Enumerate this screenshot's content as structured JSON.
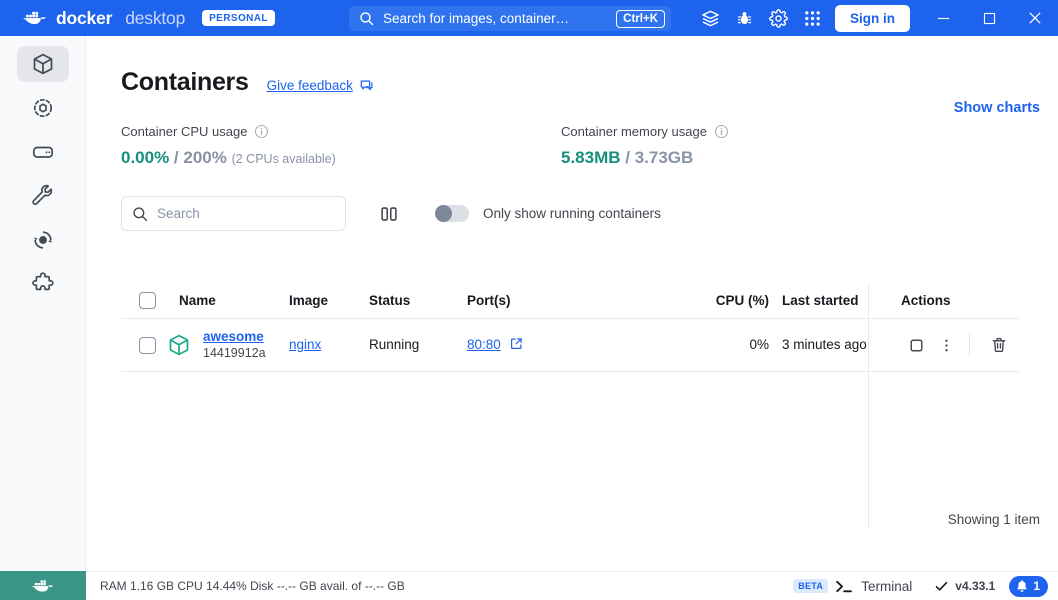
{
  "titlebar": {
    "brand_docker": "docker",
    "brand_desktop": "desktop",
    "plan_badge": "PERSONAL",
    "search_placeholder": "Search for images, container…",
    "search_shortcut": "Ctrl+K",
    "sign_in_label": "Sign in",
    "icons": [
      "extensions-icon",
      "bug-icon",
      "gear-icon",
      "apps-grid-icon"
    ],
    "window_controls": [
      "minimize",
      "maximize",
      "close"
    ],
    "accent_color": "#1d63ed"
  },
  "sidebar": {
    "items": [
      {
        "name": "containers",
        "icon": "cube-icon",
        "active": true
      },
      {
        "name": "images",
        "icon": "images-icon",
        "active": false
      },
      {
        "name": "volumes",
        "icon": "volumes-icon",
        "active": false
      },
      {
        "name": "builds",
        "icon": "wrench-icon",
        "active": false
      },
      {
        "name": "dev-environments",
        "icon": "dev-env-icon",
        "active": false
      },
      {
        "name": "extensions",
        "icon": "puzzle-icon",
        "active": false
      }
    ],
    "footer_icon": "whale-icon",
    "footer_color": "#3a9488"
  },
  "page": {
    "title": "Containers",
    "feedback_link": "Give feedback"
  },
  "stats": {
    "cpu": {
      "label": "Container CPU usage",
      "used": "0.00%",
      "separator": " / ",
      "total": "200%",
      "sub": "(2 CPUs available)"
    },
    "memory": {
      "label": "Container memory usage",
      "used": "5.83MB",
      "separator": " / ",
      "total": "3.73GB"
    },
    "show_charts": "Show charts",
    "used_color": "#168f7c"
  },
  "filters": {
    "search_placeholder": "Search",
    "search_value": "",
    "pause_button": "pause-icon",
    "toggle_label": "Only show running containers",
    "toggle_on": false
  },
  "table": {
    "columns": [
      "Name",
      "Image",
      "Status",
      "Port(s)",
      "CPU (%)",
      "Last started",
      "Actions"
    ],
    "rows": [
      {
        "name": "awesome",
        "container_id": "14419912a",
        "image": "nginx",
        "status": "Running",
        "ports": "80:80",
        "cpu": "0%",
        "last_started": "3 minutes ago",
        "actions": [
          "stop-button",
          "more-options-button",
          "delete-button"
        ]
      }
    ],
    "showing": "Showing 1 item"
  },
  "statusbar": {
    "resources": "RAM 1.16 GB  CPU 14.44%  Disk --.-- GB avail. of --.-- GB",
    "beta_badge": "BETA",
    "terminal_label": "Terminal",
    "version": "v4.33.1",
    "notification_count": "1"
  }
}
